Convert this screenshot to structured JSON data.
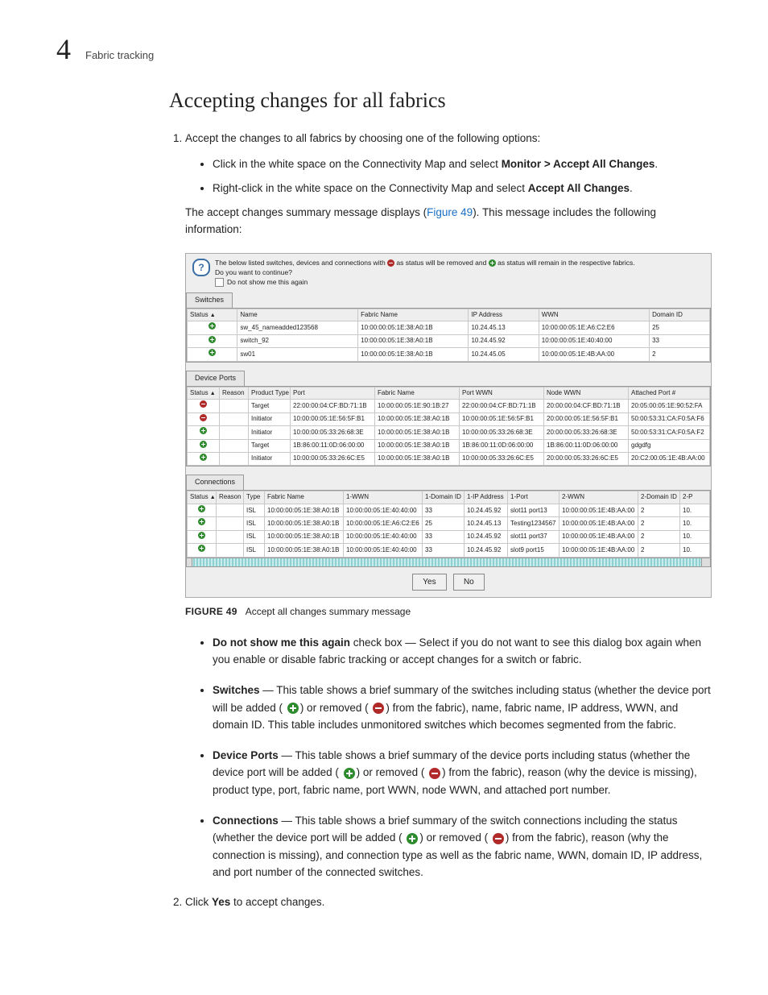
{
  "header": {
    "chapter_number": "4",
    "breadcrumb": "Fabric tracking"
  },
  "title": "Accepting changes for all fabrics",
  "step1_intro": "Accept the changes to all fabrics by choosing one of the following options:",
  "step1_bullet1_a": "Click in the white space on the Connectivity Map and select ",
  "step1_bullet1_b": "Monitor > Accept All Changes",
  "step1_bullet2_a": "Right-click in the white space on the Connectivity Map and select ",
  "step1_bullet2_b": "Accept All Changes",
  "summary_para_a": "The accept changes summary message displays (",
  "summary_para_link": "Figure 49",
  "summary_para_b": "). This message includes the following information:",
  "dialog": {
    "msg_a": "The below listed switches, devices and connections with ",
    "msg_b": " as status will be removed and ",
    "msg_c": " as status will remain in the respective fabrics.",
    "confirm": "Do you want to continue?",
    "checkbox": "Do not show me this again",
    "tabs": {
      "switches": "Switches",
      "ports": "Device Ports",
      "conns": "Connections"
    },
    "switches_headers": {
      "status": "Status",
      "name": "Name",
      "fabric": "Fabric Name",
      "ip": "IP Address",
      "wwn": "WWN",
      "domain": "Domain ID"
    },
    "switches_rows": [
      {
        "s": "g",
        "name": "sw_45_nameadded123568",
        "fab": "10:00:00:05:1E:38:A0:1B",
        "ip": "10.24.45.13",
        "wwn": "10:00:00:05:1E:A6:C2:E6",
        "dom": "25"
      },
      {
        "s": "g",
        "name": "switch_92",
        "fab": "10:00:00:05:1E:38:A0:1B",
        "ip": "10.24.45.92",
        "wwn": "10:00:00:05:1E:40:40:00",
        "dom": "33"
      },
      {
        "s": "g",
        "name": "sw01",
        "fab": "10:00:00:05:1E:38:A0:1B",
        "ip": "10.24.45.05",
        "wwn": "10:00:00:05:1E:4B:AA:00",
        "dom": "2"
      }
    ],
    "ports_headers": {
      "status": "Status",
      "reason": "Reason",
      "ptype": "Product Type",
      "port": "Port",
      "fabric": "Fabric Name",
      "pwwn": "Port WWN",
      "nwwn": "Node WWN",
      "att": "Attached Port #"
    },
    "ports_rows": [
      {
        "s": "r",
        "pt": "Target",
        "port": "22:00:00:04:CF:BD:71:1B",
        "fab": "10:00:00:05:1E:90:1B:27",
        "pw": "22:00:00:04:CF:BD:71:1B",
        "nw": "20:00:00:04:CF:BD:71:1B",
        "at": "20:05:00:05:1E:90:52:FA"
      },
      {
        "s": "r",
        "pt": "Initiator",
        "port": "10:00:00:05:1E:56:5F:B1",
        "fab": "10:00:00:05:1E:38:A0:1B",
        "pw": "10:00:00:05:1E:56:5F:B1",
        "nw": "20:00:00:05:1E:56:5F:B1",
        "at": "50:00:53:31:CA:F0:5A:F6"
      },
      {
        "s": "g",
        "pt": "Initiator",
        "port": "10:00:00:05:33:26:68:3E",
        "fab": "10:00:00:05:1E:38:A0:1B",
        "pw": "10:00:00:05:33:26:68:3E",
        "nw": "20:00:00:05:33:26:68:3E",
        "at": "50:00:53:31:CA:F0:5A:F2"
      },
      {
        "s": "g",
        "pt": "Target",
        "port": "1B:86:00:11:0D:06:00:00",
        "fab": "10:00:00:05:1E:38:A0:1B",
        "pw": "1B:86:00:11:0D:06:00:00",
        "nw": "1B:86:00:11:0D:06:00:00",
        "at": "gdgdfg"
      },
      {
        "s": "g",
        "pt": "Initiator",
        "port": "10:00:00:05:33:26:6C:E5",
        "fab": "10:00:00:05:1E:38:A0:1B",
        "pw": "10:00:00:05:33:26:6C:E5",
        "nw": "20:00:00:05:33:26:6C:E5",
        "at": "20:C2:00:05:1E:4B:AA:00"
      }
    ],
    "conns_headers": {
      "status": "Status",
      "reason": "Reason",
      "type": "Type",
      "fabric": "Fabric Name",
      "wwn1": "1-WWN",
      "dom1": "1-Domain ID",
      "ip1": "1-IP Address",
      "port1": "1-Port",
      "wwn2": "2-WWN",
      "dom2": "2-Domain ID",
      "p2": "2-P"
    },
    "conns_rows": [
      {
        "s": "g",
        "ty": "ISL",
        "fab": "10:00:00:05:1E:38:A0:1B",
        "w1": "10:00:00:05:1E:40:40:00",
        "d1": "33",
        "ip1": "10.24.45.92",
        "p1": "slot11 port13",
        "w2": "10:00:00:05:1E:4B:AA:00",
        "d2": "2",
        "p2": "10."
      },
      {
        "s": "g",
        "ty": "ISL",
        "fab": "10:00:00:05:1E:38:A0:1B",
        "w1": "10:00:00:05:1E:A6:C2:E6",
        "d1": "25",
        "ip1": "10.24.45.13",
        "p1": "Testing1234567",
        "w2": "10:00:00:05:1E:4B:AA:00",
        "d2": "2",
        "p2": "10."
      },
      {
        "s": "g",
        "ty": "ISL",
        "fab": "10:00:00:05:1E:38:A0:1B",
        "w1": "10:00:00:05:1E:40:40:00",
        "d1": "33",
        "ip1": "10.24.45.92",
        "p1": "slot11 port37",
        "w2": "10:00:00:05:1E:4B:AA:00",
        "d2": "2",
        "p2": "10."
      },
      {
        "s": "g",
        "ty": "ISL",
        "fab": "10:00:00:05:1E:38:A0:1B",
        "w1": "10:00:00:05:1E:40:40:00",
        "d1": "33",
        "ip1": "10.24.45.92",
        "p1": "slot9 port15",
        "w2": "10:00:00:05:1E:4B:AA:00",
        "d2": "2",
        "p2": "10."
      }
    ],
    "yes": "Yes",
    "no": "No"
  },
  "figure": {
    "label": "FIGURE 49",
    "caption": "Accept all changes summary message"
  },
  "desc": {
    "d1a": "Do not show me this again",
    "d1b": " check box — Select if you do not want to see this dialog box again when you enable or disable fabric tracking or accept changes for a switch or fabric.",
    "d2a": "Switches",
    "d2b": " — This table shows a brief summary of the switches including status (whether the device port will be added ( ",
    "d2c": ") or removed ( ",
    "d2d": ") from the fabric), name, fabric name, IP address, WWN, and domain ID. This table includes unmonitored switches which becomes segmented from the fabric.",
    "d3a": "Device Ports",
    "d3b": " — This table shows a brief summary of the device ports including status (whether the device port will be added ( ",
    "d3c": ") or removed ( ",
    "d3d": ") from the fabric), reason (why the device is missing), product type, port, fabric name, port WWN, node WWN, and attached port number.",
    "d4a": "Connections",
    "d4b": " — This table shows a brief summary of the switch connections including the status (whether the device port will be added ( ",
    "d4c": ") or removed ( ",
    "d4d": ") from the fabric), reason (why the connection is missing), and connection type as well as the fabric name, WWN, domain ID, IP address, and port number of the connected switches."
  },
  "step2_a": "Click ",
  "step2_b": "Yes",
  "step2_c": " to accept changes."
}
